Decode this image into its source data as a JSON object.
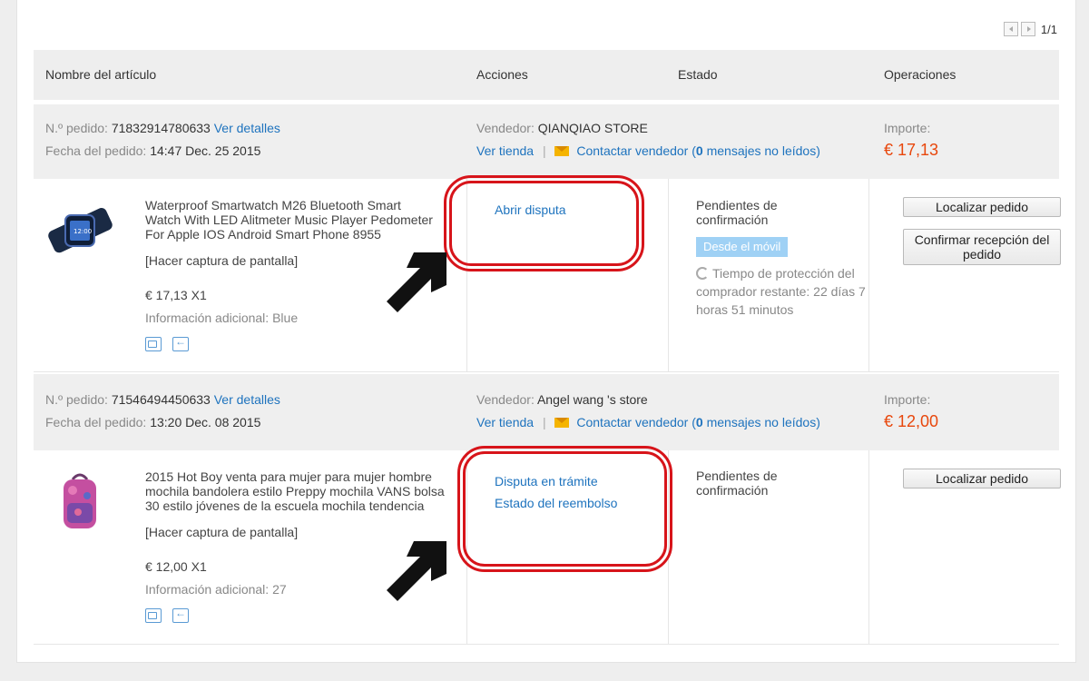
{
  "pagination": {
    "label": "1/1"
  },
  "table_headers": {
    "item_name": "Nombre del artículo",
    "actions": "Acciones",
    "status": "Estado",
    "operations": "Operaciones"
  },
  "common": {
    "order_no_label": "N.º pedido:",
    "view_details": "Ver detalles",
    "order_date_label": "Fecha del pedido:",
    "seller_label": "Vendedor:",
    "view_store": "Ver tienda",
    "separator": "|",
    "contact_seller": "Contactar vendedor",
    "unread_prefix": "(",
    "unread_suffix": "mensajes no leídos)",
    "amount_label": "Importe:",
    "screenshot_link": "[Hacer captura de pantalla]",
    "extra_info_label": "Información adicional:",
    "track_order": "Localizar pedido"
  },
  "orders": [
    {
      "order_no": "71832914780633",
      "order_date": "14:47 Dec. 25 2015",
      "seller": "QIANQIAO STORE",
      "unread_count": "0",
      "amount": "€ 17,13",
      "product_title_lines": [
        "Waterproof Smartwatch M26 Bluetooth Smart",
        "Watch With LED Alitmeter Music Player Pedometer",
        "For Apple IOS Android Smart Phone 8955"
      ],
      "price_qty": "€ 17,13 X1",
      "extra_info_value": "Blue",
      "actions": [
        "Abrir disputa"
      ],
      "status_lines": [
        "Pendientes de",
        "confirmación"
      ],
      "badge": "Desde el móvil",
      "protection_text": "Tiempo de protección del comprador restante: 22 días 7 horas 51 minutos",
      "buttons": [
        "Localizar pedido",
        "Confirmar recepción del pedido"
      ],
      "icons": [
        "truck-icon",
        "return-icon"
      ]
    },
    {
      "order_no": "71546494450633",
      "order_date": "13:20 Dec. 08 2015",
      "seller": "Angel wang 's store",
      "unread_count": "0",
      "amount": "€ 12,00",
      "product_title_lines": [
        "2015 Hot Boy venta para mujer para mujer hombre",
        "mochila bandolera estilo Preppy mochila VANS bolsa",
        "30 estilo jóvenes de la escuela mochila tendencia"
      ],
      "price_qty": "€ 12,00 X1",
      "extra_info_value": "27",
      "actions": [
        "Disputa en trámite",
        "Estado del reembolso"
      ],
      "status_lines": [
        "Pendientes de",
        "confirmación"
      ],
      "buttons": [
        "Localizar pedido"
      ],
      "icons": [
        "truck-icon",
        "return-icon"
      ]
    }
  ],
  "colors": {
    "link": "#1e73be",
    "price": "#e8470c",
    "highlight": "#d7141a",
    "badge": "#9fd1f5"
  }
}
